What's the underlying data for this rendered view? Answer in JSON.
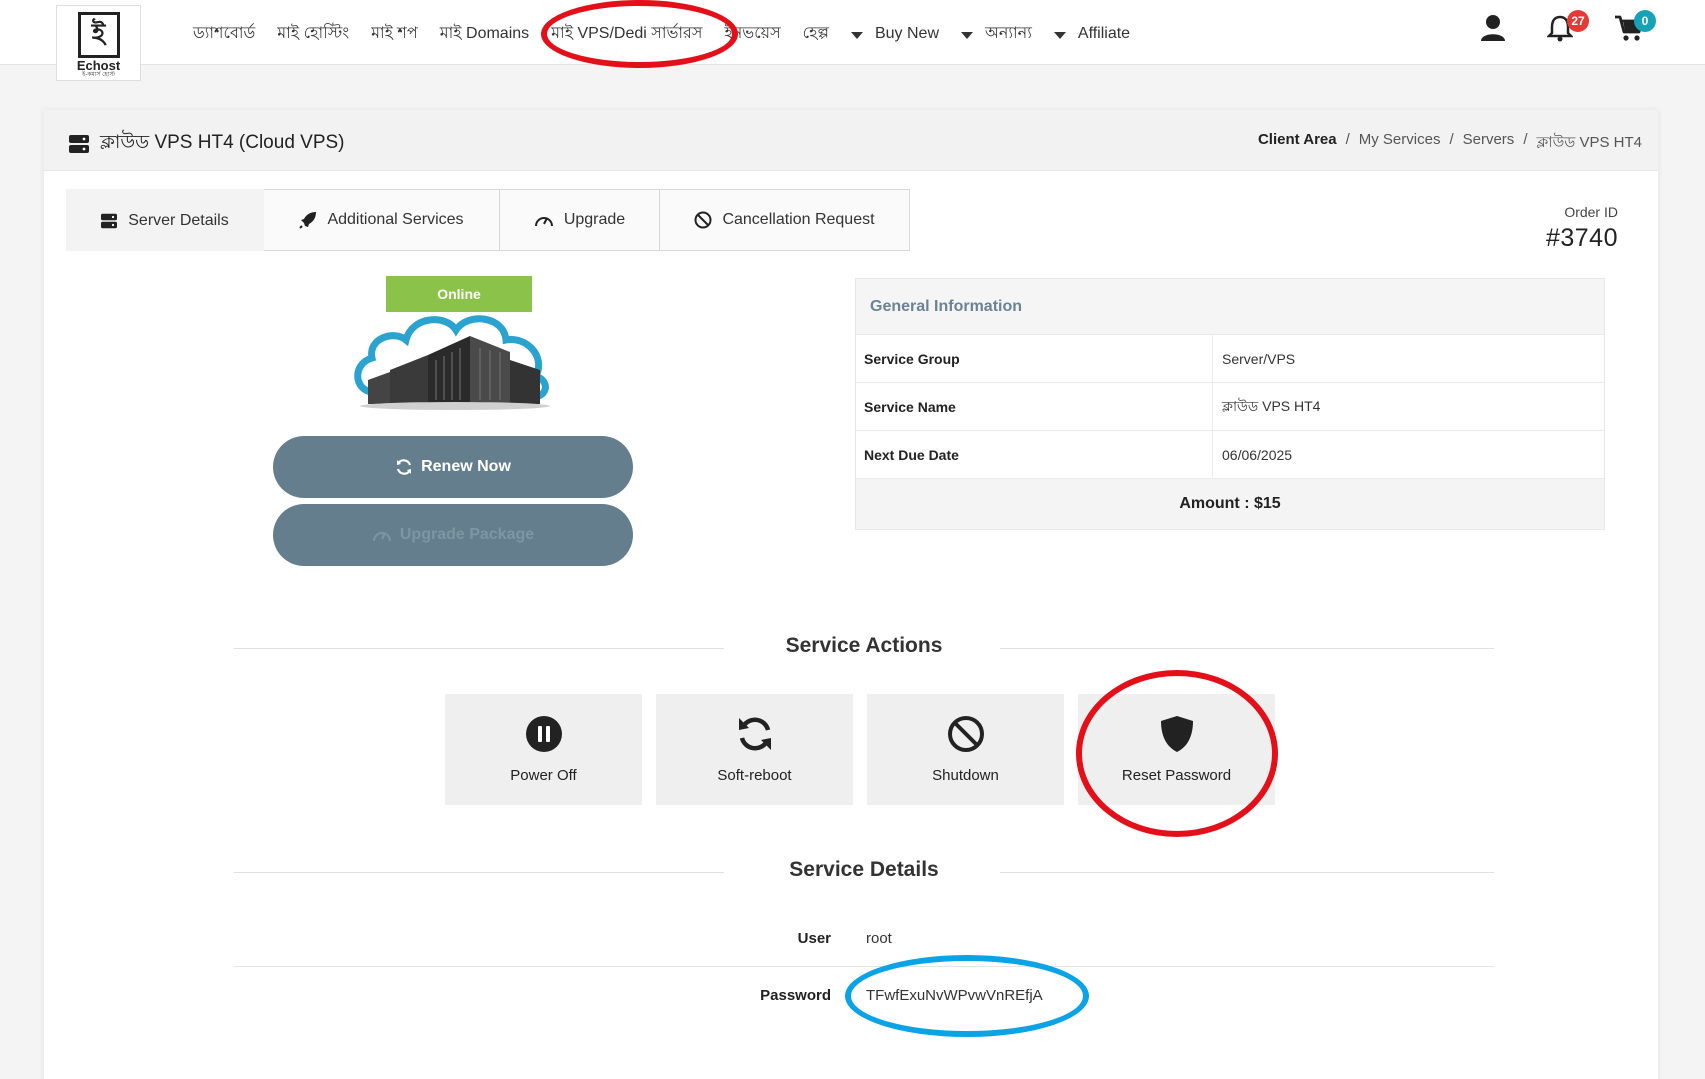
{
  "logo": {
    "text": "Echost",
    "sub": "ই-কমার্স হোস্ট"
  },
  "nav": {
    "items": [
      "ড্যাশবোর্ড",
      "মাই হোস্টিং",
      "মাই শপ",
      "মাই Domains",
      "মাই VPS/Dedi সার্ভারস",
      "ইনভয়েস",
      "হেল্প",
      "Buy New",
      "অন্যান্য",
      "Affiliate"
    ]
  },
  "header_icons": {
    "notifications_count": "27",
    "cart_count": "0",
    "notification_color": "#e53935",
    "cart_color": "#17a2b8"
  },
  "page": {
    "title": "ক্লাউড VPS HT4 (Cloud VPS)",
    "breadcrumb": [
      "Client Area",
      "My Services",
      "Servers",
      "ক্লাউড VPS HT4"
    ]
  },
  "tabs": [
    "Server Details",
    "Additional Services",
    "Upgrade",
    "Cancellation Request"
  ],
  "order": {
    "label": "Order ID",
    "number": "#3740"
  },
  "product": {
    "status": "Online",
    "renew_label": "Renew Now",
    "upgrade_label": "Upgrade Package"
  },
  "info": {
    "heading": "General Information",
    "rows": [
      {
        "key": "Service Group",
        "value": "Server/VPS"
      },
      {
        "key": "Service Name",
        "value": "ক্লাউড VPS HT4"
      },
      {
        "key": "Next Due Date",
        "value": "06/06/2025"
      }
    ],
    "amount": "Amount : $15"
  },
  "service_actions": {
    "title": "Service Actions",
    "items": [
      "Power Off",
      "Soft-reboot",
      "Shutdown",
      "Reset Password"
    ]
  },
  "service_details": {
    "title": "Service Details",
    "user_label": "User",
    "user_value": "root",
    "password_label": "Password",
    "password_value": "TFwfExuNvWPvwVnREfjA"
  },
  "colors": {
    "accent_button": "#647e8d",
    "online_green": "#8bc34a",
    "annotation_red": "#e3101a",
    "annotation_blue": "#0aa3e6"
  }
}
